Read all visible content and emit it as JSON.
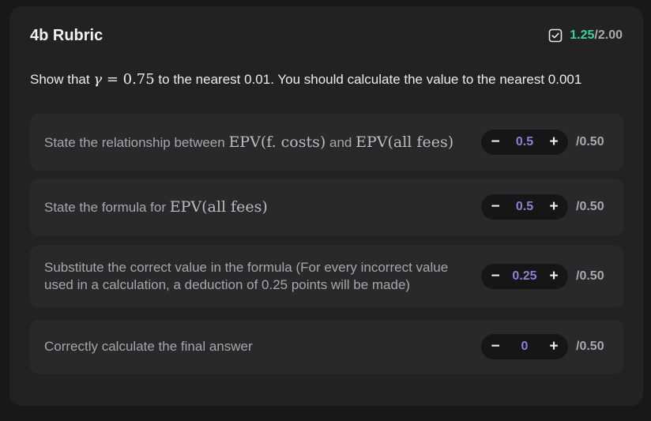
{
  "rubric": {
    "title": "4b Rubric",
    "score_earned": "1.25",
    "score_sep": "/",
    "score_total": "2.00",
    "icon": "checkbox-check-icon",
    "colors": {
      "earned": "#35d49a",
      "value": "#8f7fd4"
    }
  },
  "question": {
    "prefix": "Show that ",
    "var": "γ",
    "eq": " = 0.75",
    "suffix": " to the nearest 0.01. You should calculate the value to the nearest 0.001"
  },
  "criteria": [
    {
      "parts": [
        {
          "t": "State the relationship between ",
          "m": false
        },
        {
          "t": "EPV(f. costs)",
          "m": true
        },
        {
          "t": " and ",
          "m": false
        },
        {
          "t": "EPV(all fees)",
          "m": true
        }
      ],
      "value": "0.5",
      "max": "/0.50"
    },
    {
      "parts": [
        {
          "t": "State the formula for ",
          "m": false
        },
        {
          "t": "EPV(all fees)",
          "m": true
        }
      ],
      "value": "0.5",
      "max": "/0.50"
    },
    {
      "parts": [
        {
          "t": "Substitute the correct value in the formula (For every incorrect value used in a calculation, a deduction of 0.25 points will be made)",
          "m": false
        }
      ],
      "value": "0.25",
      "max": "/0.50"
    },
    {
      "parts": [
        {
          "t": "Correctly calculate the final answer",
          "m": false
        }
      ],
      "value": "0",
      "max": "/0.50"
    }
  ],
  "stepper": {
    "minus": "−",
    "plus": "+"
  }
}
